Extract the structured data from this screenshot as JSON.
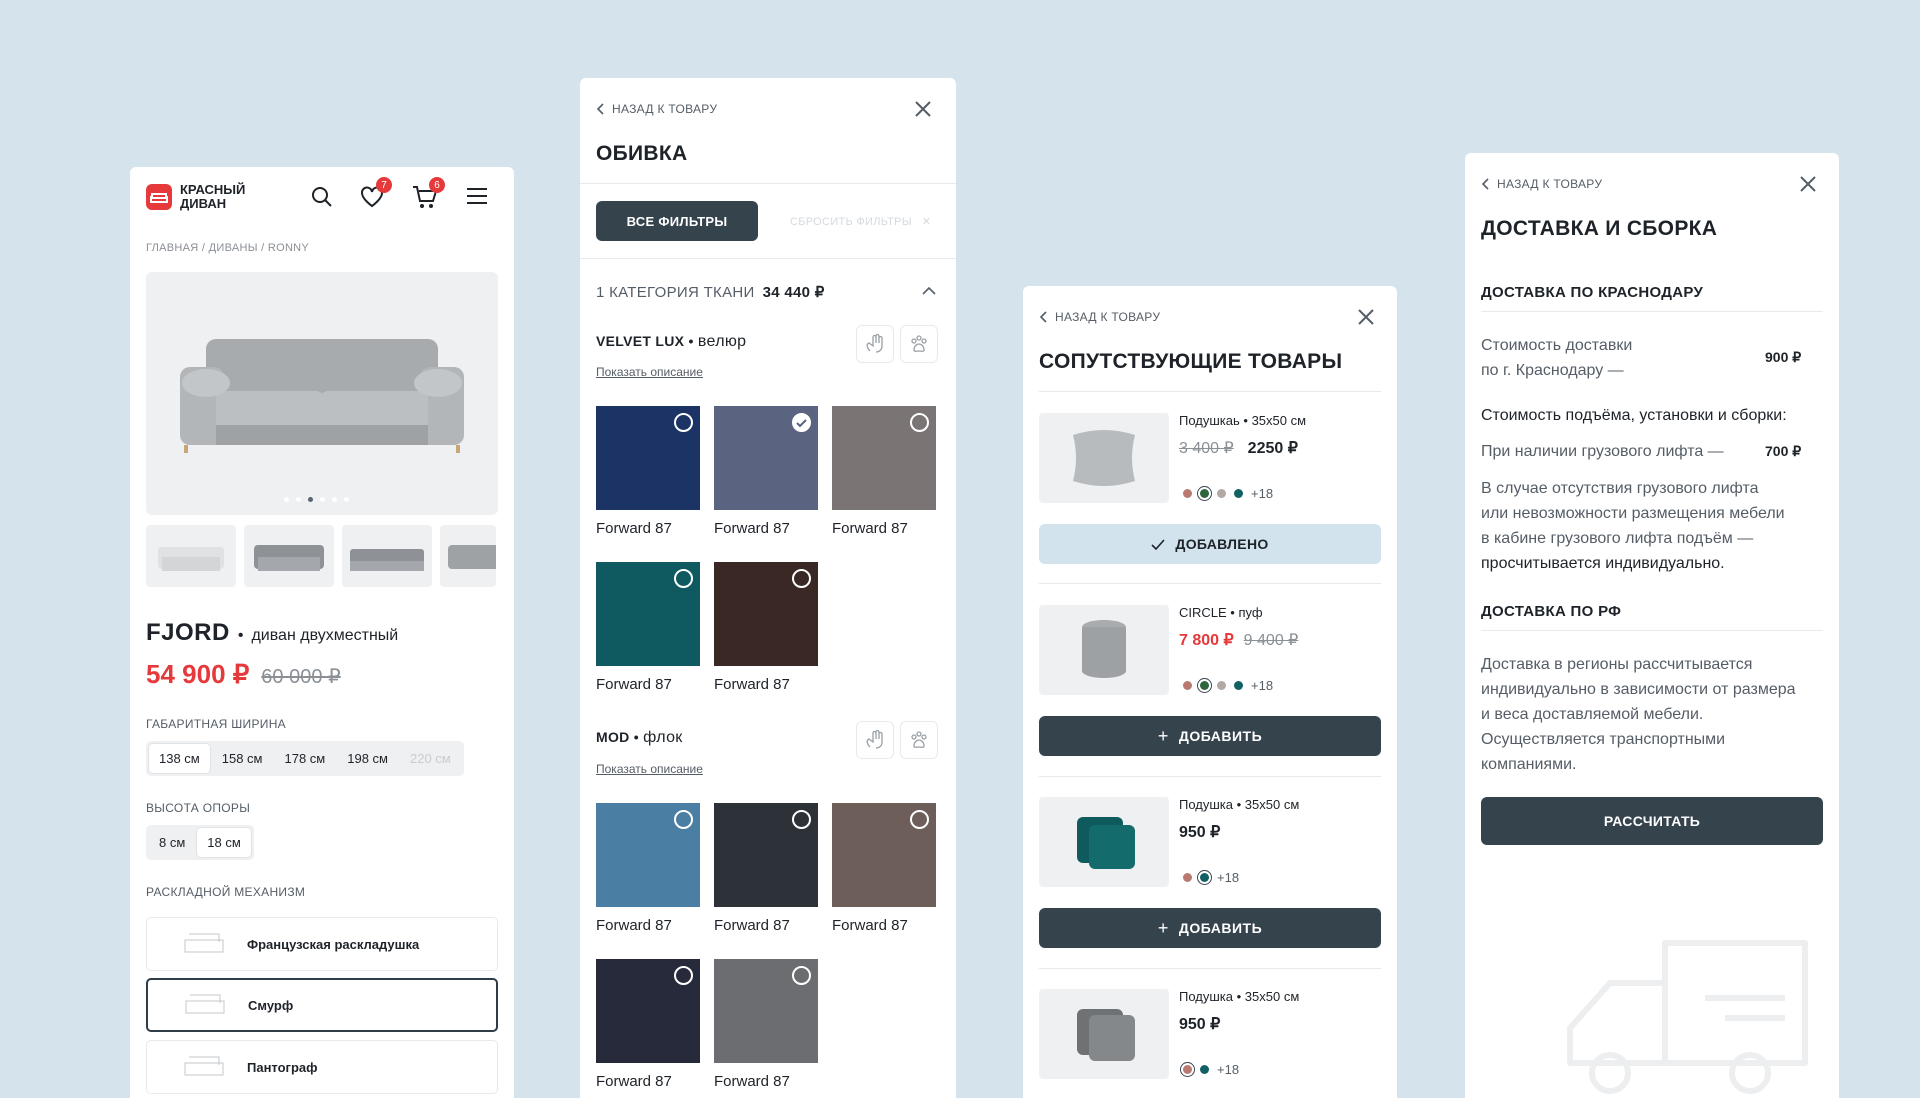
{
  "panel_product": {
    "logo_line1": "КРАСНЫЙ",
    "logo_line2": "ДИВАН",
    "wishlist_count": "7",
    "cart_count": "6",
    "breadcrumb": "ГЛАВНАЯ / ДИВАНЫ / RONNY",
    "product_name": "FJORD",
    "product_type": "диван двухместный",
    "price": "54 900 ₽",
    "old_price": "60 000 ₽",
    "width_label": "ГАБАРИТНАЯ ШИРИНА",
    "widths": [
      "138 см",
      "158 см",
      "178 см",
      "198 см",
      "220 см"
    ],
    "height_label": "ВЫСОТА ОПОРЫ",
    "heights": [
      "8 см",
      "18 см"
    ],
    "mechanism_label": "РАСКЛАДНОЙ МЕХАНИЗМ",
    "mechanisms": [
      "Французская раскладушка",
      "Смурф",
      "Пантограф"
    ]
  },
  "panel_upholstery": {
    "back_label": "НАЗАД К ТОВАРУ",
    "title": "ОБИВКА",
    "all_filters": "ВСЕ ФИЛЬТРЫ",
    "reset_filters": "СБРОСИТЬ ФИЛЬТРЫ",
    "category_label": "1 КАТЕГОРИЯ ТКАНИ",
    "category_price": "34 440 ₽",
    "fabric1_name": "VELVET LUX",
    "fabric1_type": "велюр",
    "fabric2_name": "MOD",
    "fabric2_type": "флок",
    "show_description": "Показать описание",
    "swatch_label": "Forward 87",
    "colors": {
      "navy": "#1c3366",
      "slate": "#5a6480",
      "taupe": "#7a7475",
      "teal": "#0f5a60",
      "brown": "#3a2824",
      "blue2": "#4a7fa3",
      "charcoal": "#2d3238",
      "mocha": "#6e5e5a",
      "ink": "#262a3a",
      "grey": "#6c6d70"
    }
  },
  "panel_related": {
    "back_label": "НАЗАД К ТОВАРУ",
    "title": "СОПУТСТВУЮЩИЕ ТОВАРЫ",
    "items": [
      {
        "name": "Подушкаь",
        "size": "35x50 см",
        "old_price": "3 400 ₽",
        "price": "2250 ₽",
        "more": "+18",
        "button": "ДОБАВЛЕНО"
      },
      {
        "name": "CIRCLE",
        "size": "пуф",
        "price": "7 800 ₽",
        "old_price": "9 400 ₽",
        "more": "+18",
        "button": "ДОБАВИТЬ"
      },
      {
        "name": "Подушка",
        "size": "35x50 см",
        "price": "950 ₽",
        "more": "+18",
        "button": "ДОБАВИТЬ"
      },
      {
        "name": "Подушка",
        "size": "35x50 см",
        "price": "950 ₽",
        "more": "+18"
      }
    ]
  },
  "panel_delivery": {
    "back_label": "НАЗАД К ТОВАРУ",
    "title": "ДОСТАВКА И СБОРКА",
    "section1": "ДОСТАВКА ПО КРАСНОДАРУ",
    "cost_line1": "Стоимость доставки",
    "cost_line2": "по г. Краснодару —",
    "cost_value": "900 ₽",
    "assembly_title": "Стоимость подъёма, установки и сборки:",
    "lift_text": "При наличии грузового лифта —",
    "lift_value": "700 ₽",
    "nolift_1": "В случае отсутствия грузового лифта",
    "nolift_2": "или невозможности размещения мебели",
    "nolift_3": "в кабине грузового лифта подъём —",
    "nolift_4": "просчитывается индивидуально.",
    "section2": "ДОСТАВКА ПО РФ",
    "rf_1": "Доставка в регионы рассчитывается",
    "rf_2": "индивидуально в зависимости от размера",
    "rf_3": "и веса доставляемой мебели.",
    "rf_4": "Осуществляется транспортными",
    "rf_5": "компаниями.",
    "calc_button": "РАССЧИТАТЬ"
  }
}
